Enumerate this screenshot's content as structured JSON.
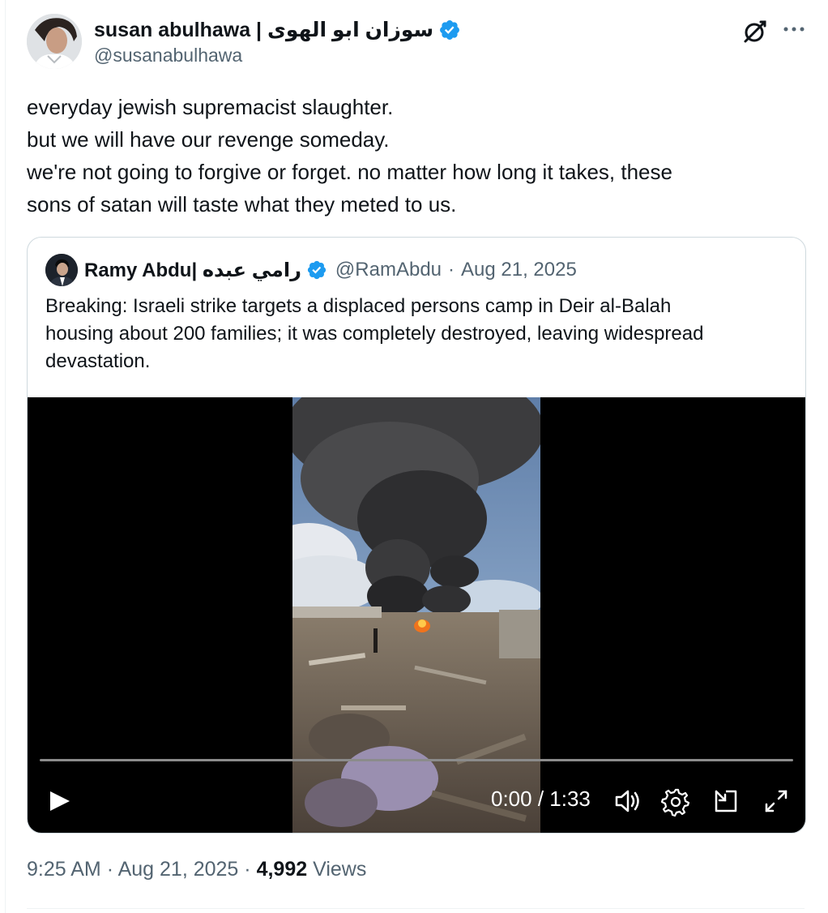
{
  "author": {
    "name": "susan abulhawa | سوزان ابو الهوى",
    "handle": "@susanabulhawa",
    "verified": true
  },
  "icons": {
    "verified": "verified-badge-icon",
    "grok": "grok-icon",
    "more": "more-icon",
    "play": "play-icon",
    "volume": "volume-icon",
    "settings": "gear-icon",
    "pip": "picture-in-picture-icon",
    "fullscreen": "fullscreen-icon"
  },
  "tweet": {
    "lines": [
      "everyday jewish supremacist slaughter.",
      "but we will have our revenge someday.",
      "we're not going to forgive or forget. no matter how long it takes, these",
      "sons of satan will taste what they meted to us."
    ]
  },
  "quoted": {
    "name": "Ramy Abdu| رامي عبده",
    "handle": "@RamAbdu",
    "separator": "·",
    "date": "Aug 21, 2025",
    "lines": [
      "Breaking: Israeli strike targets a displaced persons camp in Deir al-Balah",
      "housing about 200 families; it was completely destroyed, leaving widespread",
      "devastation."
    ],
    "video": {
      "time": "0:00 / 1:33",
      "progress": 0
    }
  },
  "footer": {
    "time": "9:25 AM",
    "sep1": "·",
    "date": "Aug 21, 2025",
    "sep2": "·",
    "views_count": "4,992",
    "views_label": "Views"
  },
  "colors": {
    "verified_blue": "#1d9bf0",
    "secondary_text": "#536471",
    "primary_text": "#0f1419",
    "border": "#cfd9de"
  }
}
